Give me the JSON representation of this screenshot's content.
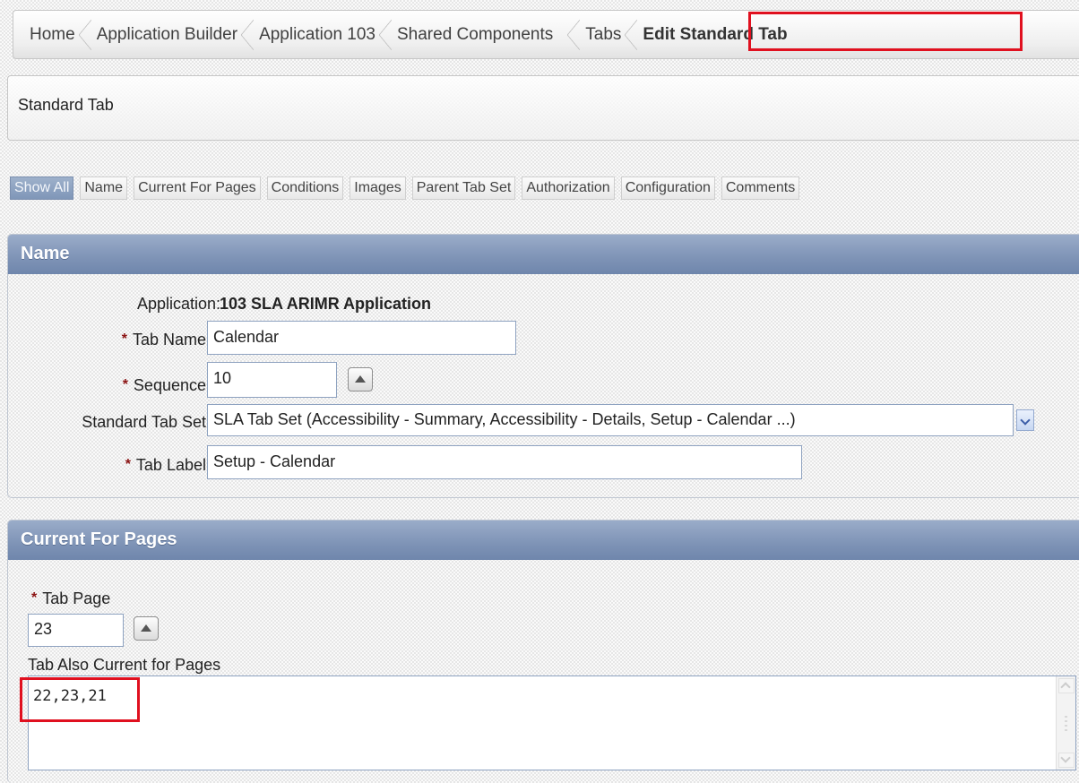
{
  "breadcrumb": {
    "items": [
      "Home",
      "Application Builder",
      "Application 103",
      "Shared Components",
      "Tabs"
    ],
    "current": "Edit Standard Tab"
  },
  "region_title": "Standard Tab",
  "jump_buttons": [
    "Show All",
    "Name",
    "Current For Pages",
    "Conditions",
    "Images",
    "Parent Tab Set",
    "Authorization",
    "Configuration",
    "Comments"
  ],
  "name_section": {
    "title": "Name",
    "application_label": "Application:",
    "application_value": "103 SLA ARIMR Application",
    "tab_name_label": "Tab Name",
    "tab_name_value": "Calendar",
    "sequence_label": "Sequence",
    "sequence_value": "10",
    "tab_set_label": "Standard Tab Set",
    "tab_set_value": "SLA Tab Set (Accessibility - Summary, Accessibility - Details, Setup - Calendar ...)",
    "tab_label_label": "Tab Label",
    "tab_label_value": "Setup - Calendar"
  },
  "current_pages_section": {
    "title": "Current For Pages",
    "tab_page_label": "Tab Page",
    "tab_page_value": "23",
    "also_current_label": "Tab Also Current for Pages",
    "also_current_value": "22,23,21"
  },
  "required_marker": "*",
  "colors": {
    "panel_header": "#7e93b6",
    "highlight": "#e0101f",
    "required": "#8b1212"
  }
}
